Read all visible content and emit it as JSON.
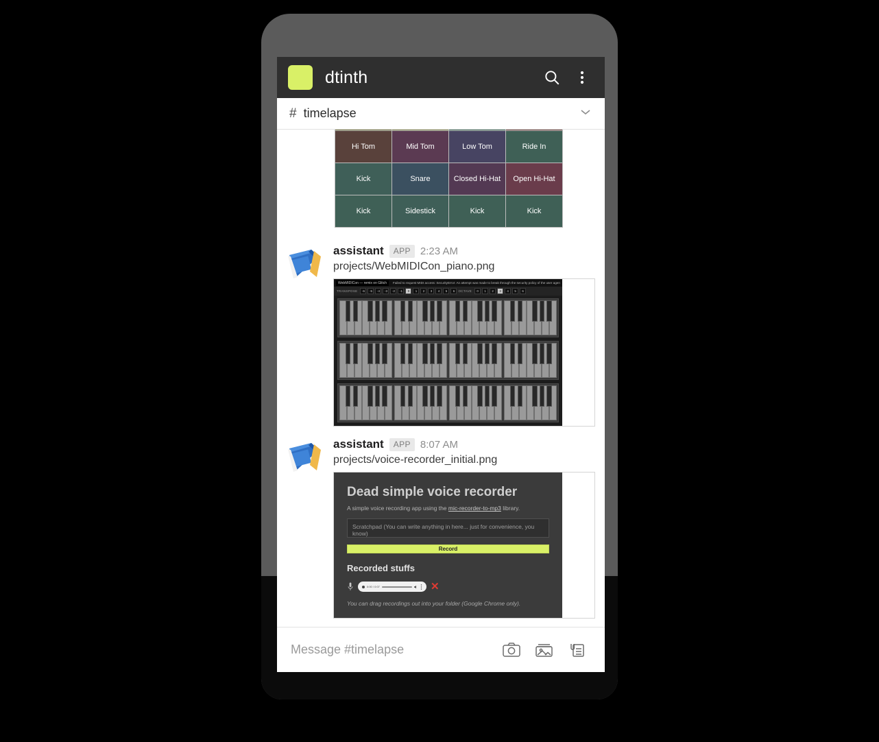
{
  "header": {
    "workspace": "dtinth",
    "search_icon": "search-icon",
    "overflow_icon": "kebab-menu-icon"
  },
  "channel": {
    "hash": "#",
    "name": "timelapse",
    "chevron_icon": "chevron-down-icon"
  },
  "drum_machine": {
    "rows": [
      [
        "Hi Tom",
        "Mid Tom",
        "Low Tom",
        "Ride In"
      ],
      [
        "Kick",
        "Snare",
        "Closed Hi-Hat",
        "Open Hi-Hat"
      ],
      [
        "Kick",
        "Sidestick",
        "Kick",
        "Kick"
      ]
    ],
    "colors": [
      [
        "#59413b",
        "#5b3a52",
        "#474462",
        "#3f6056"
      ],
      [
        "#3f5f58",
        "#3b5060",
        "#533953",
        "#6a3c4b"
      ],
      [
        "#3f6056",
        "#3f5f58",
        "#3f6056",
        "#3f6056"
      ]
    ],
    "clipped_row_colors": [
      "#6a6b33",
      "#7a7c44",
      "#2f5b49",
      "#5e332f"
    ]
  },
  "messages": [
    {
      "author": "assistant",
      "badge": "APP",
      "time": "2:23 AM",
      "filename": "projects/WebMIDICon_piano.png",
      "icon": "notebook-icon"
    },
    {
      "author": "assistant",
      "badge": "APP",
      "time": "8:07 AM",
      "filename": "projects/voice-recorder_initial.png",
      "icon": "notebook-icon"
    }
  ],
  "piano_screenshot": {
    "app_title": "WebMIDICon — remix on Glitch",
    "error_text": "Failed to request MIDI access: SecurityError: An attempt was made to break through the security policy of the user agent.",
    "transpose_label": "TRANSPOSE",
    "transpose_values": [
      "-6",
      "-5",
      "-4",
      "-3",
      "-2",
      "-1",
      "0",
      "1",
      "2",
      "3",
      "4",
      "5",
      "6"
    ],
    "transpose_selected": "0",
    "octave_label": "OCTAVE",
    "octave_values": [
      "0",
      "1",
      "2",
      "3",
      "4",
      "5",
      "6"
    ],
    "octave_selected": "3",
    "keyboard_rows": 3,
    "octaves_per_row": 4
  },
  "voice_recorder": {
    "title": "Dead simple voice recorder",
    "subtitle_before": "A simple voice recording app using the ",
    "subtitle_link": "mic-recorder-to-mp3",
    "subtitle_after": " library.",
    "scratchpad_placeholder": "Scratchpad (You can write anything in here... just for convenience, you know)",
    "record_button": "Record",
    "recorded_heading": "Recorded stuffs",
    "player_time": "0:00 / 0:07",
    "delete_icon": "delete-x-icon",
    "mic_icon": "microphone-icon",
    "note": "You can drag recordings out into your folder (Google Chrome only)."
  },
  "composer": {
    "placeholder": "Message #timelapse",
    "camera_icon": "camera-icon",
    "gallery_icon": "photo-gallery-icon",
    "attachment_icon": "document-attachment-icon"
  },
  "colors": {
    "accent_green": "#d9f067",
    "header_dark": "#2f2f2f",
    "delete_red": "#e03b33"
  }
}
